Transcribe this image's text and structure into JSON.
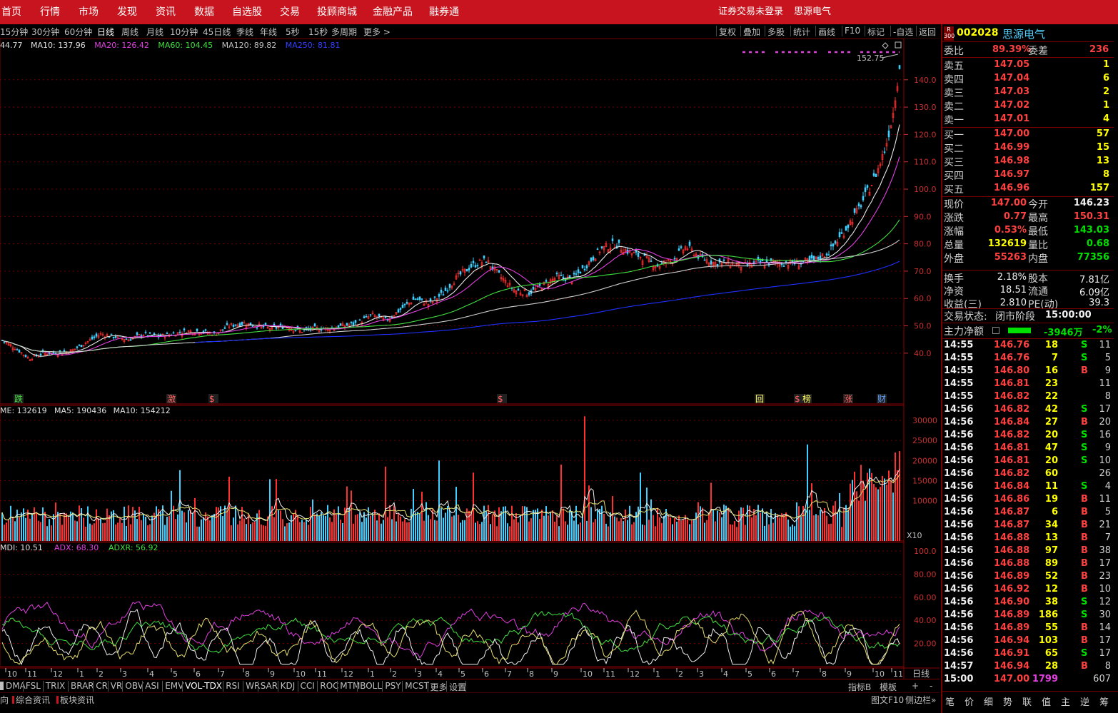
{
  "top_nav": {
    "items": [
      "首页",
      "行情",
      "市场",
      "发现",
      "资讯",
      "数据",
      "自选股",
      "交易",
      "投顾商城",
      "金融产品",
      "融券通"
    ],
    "login_status": "证券交易未登录",
    "stock_name": "思源电气"
  },
  "period_bar": {
    "items": [
      "15分钟",
      "30分钟",
      "60分钟",
      "日线",
      "周线",
      "月线",
      "10分钟",
      "45日线",
      "季线",
      "年线",
      "5秒",
      "15秒",
      "多周期",
      "更多 >"
    ],
    "active": "日线",
    "tools": [
      "复权",
      "叠加",
      "多股",
      "统计",
      "画线",
      "F10",
      "标记",
      "-自选",
      "返回"
    ]
  },
  "ma_legend": [
    {
      "text": "44.77",
      "color": "#e0e0e0"
    },
    {
      "text": "MA10: 137.96",
      "color": "#e0e0e0"
    },
    {
      "text": "MA20: 126.42",
      "color": "#e040e0"
    },
    {
      "text": "MA60: 104.45",
      "color": "#40e040"
    },
    {
      "text": "MA120: 89.82",
      "color": "#c0c0c0"
    },
    {
      "text": "MA250: 81.81",
      "color": "#3040ff"
    }
  ],
  "price_axis": [
    "140.0",
    "130.0",
    "120.0",
    "110.0",
    "100.0",
    "90.0",
    "80.0",
    "70.0",
    "60.0",
    "50.0",
    "40.0"
  ],
  "price_high_label": "152.75",
  "event_markers": [
    {
      "text": "跌",
      "color": "#40e040"
    },
    {
      "text": "激",
      "color": "#ff6060"
    },
    {
      "text": "$",
      "color": "#ff6060"
    },
    {
      "text": "$",
      "color": "#ff6060"
    },
    {
      "text": "回",
      "color": "#ffff60"
    },
    {
      "text": "$",
      "color": "#ff6060"
    },
    {
      "text": "榜",
      "color": "#ffff60"
    },
    {
      "text": "涨",
      "color": "#ff6060"
    },
    {
      "text": "财",
      "color": "#60a0ff"
    }
  ],
  "volume_legend": [
    {
      "text": "ME: 132619",
      "color": "#e0e0e0"
    },
    {
      "text": "MA5: 190436",
      "color": "#e0e0e0"
    },
    {
      "text": "MA10: 154212",
      "color": "#e0e0e0"
    }
  ],
  "volume_axis": [
    "30000",
    "25000",
    "20000",
    "15000",
    "10000"
  ],
  "volume_unit": "X10",
  "dmi_legend": [
    {
      "text": "MDI: 10.51",
      "color": "#e0e0e0"
    },
    {
      "text": "ADX: 68.30",
      "color": "#e040e0"
    },
    {
      "text": "ADXR: 56.92",
      "color": "#40e040"
    }
  ],
  "dmi_axis": [
    "100.0",
    "80.00",
    "60.00",
    "40.00",
    "20.00"
  ],
  "month_axis": [
    "10",
    "11",
    "12",
    "1",
    "2",
    "3",
    "4",
    "5",
    "6",
    "7",
    "8",
    "9",
    "10",
    "11",
    "12",
    "1",
    "2",
    "3",
    "4",
    "5",
    "6",
    "7",
    "8",
    "9",
    "10",
    "11",
    "12",
    "1",
    "2",
    "3",
    "4",
    "5",
    "6",
    "7",
    "8",
    "9",
    "10",
    "11"
  ],
  "period_label": "日线",
  "indicator_tabs": [
    "DMA",
    "FSL",
    "TRIX",
    "BRAR",
    "CR",
    "VR",
    "OBV",
    "ASI",
    "EMV",
    "VOL-TDX",
    "RSI",
    "WR",
    "SAR",
    "KDJ",
    "CCI",
    "ROC",
    "MTM",
    "BOLL",
    "PSY",
    "MCST",
    "更多",
    "设置"
  ],
  "indicator_right": [
    "指标B",
    "模板",
    "+",
    "-"
  ],
  "bottom_tabs": [
    "向",
    "综合资讯",
    "板块资讯"
  ],
  "bottom_right": [
    "图文F10",
    "侧边栏»"
  ],
  "quote": {
    "badge_top": "R",
    "badge_bottom": "300",
    "code": "002028",
    "name": "思源电气",
    "weibi_label": "委比",
    "weibi": "89.39%",
    "weicha_label": "委差",
    "weicha": "236",
    "asks": [
      {
        "label": "卖五",
        "price": "147.05",
        "vol": "1"
      },
      {
        "label": "卖四",
        "price": "147.04",
        "vol": "6"
      },
      {
        "label": "卖三",
        "price": "147.03",
        "vol": "2"
      },
      {
        "label": "卖二",
        "price": "147.02",
        "vol": "1"
      },
      {
        "label": "卖一",
        "price": "147.01",
        "vol": "4"
      }
    ],
    "bids": [
      {
        "label": "买一",
        "price": "147.00",
        "vol": "57"
      },
      {
        "label": "买二",
        "price": "146.99",
        "vol": "15"
      },
      {
        "label": "买三",
        "price": "146.98",
        "vol": "13"
      },
      {
        "label": "买四",
        "price": "146.97",
        "vol": "8"
      },
      {
        "label": "买五",
        "price": "146.96",
        "vol": "157"
      }
    ],
    "stats": [
      {
        "l1": "现价",
        "v1": "147.00",
        "c1": "red",
        "l2": "今开",
        "v2": "146.23",
        "c2": "white"
      },
      {
        "l1": "涨跌",
        "v1": "0.77",
        "c1": "red",
        "l2": "最高",
        "v2": "150.31",
        "c2": "red"
      },
      {
        "l1": "涨幅",
        "v1": "0.53%",
        "c1": "red",
        "l2": "最低",
        "v2": "143.03",
        "c2": "green"
      },
      {
        "l1": "总量",
        "v1": "132619",
        "c1": "yellow",
        "l2": "量比",
        "v2": "0.68",
        "c2": "green"
      },
      {
        "l1": "外盘",
        "v1": "55263",
        "c1": "red",
        "l2": "内盘",
        "v2": "77356",
        "c2": "green"
      }
    ],
    "stats2": [
      {
        "l1": "换手",
        "v1": "2.18%",
        "l2": "股本",
        "v2": "7.81亿"
      },
      {
        "l1": "净资",
        "v1": "18.51",
        "l2": "流通",
        "v2": "6.09亿"
      },
      {
        "l1": "收益(三)",
        "v1": "2.810",
        "l2": "PE(动)",
        "v2": "39.3"
      }
    ],
    "trade_status_label": "交易状态:",
    "trade_status": "闭市阶段",
    "trade_time": "15:00:00",
    "main_net_label": "主力净额",
    "main_net": "-3946万",
    "main_net_pct": "-2%",
    "ticks": [
      {
        "t": "14:55",
        "p": "146.76",
        "v": "18",
        "s": "S",
        "n": "11"
      },
      {
        "t": "14:55",
        "p": "146.76",
        "v": "7",
        "s": "S",
        "n": "5"
      },
      {
        "t": "14:55",
        "p": "146.80",
        "v": "16",
        "s": "B",
        "n": "9"
      },
      {
        "t": "14:55",
        "p": "146.81",
        "v": "23",
        "s": "",
        "n": "11"
      },
      {
        "t": "14:55",
        "p": "146.82",
        "v": "22",
        "s": "",
        "n": "8"
      },
      {
        "t": "14:56",
        "p": "146.82",
        "v": "42",
        "s": "S",
        "n": "17"
      },
      {
        "t": "14:56",
        "p": "146.84",
        "v": "27",
        "s": "B",
        "n": "20"
      },
      {
        "t": "14:56",
        "p": "146.82",
        "v": "20",
        "s": "S",
        "n": "16"
      },
      {
        "t": "14:56",
        "p": "146.81",
        "v": "47",
        "s": "S",
        "n": "9"
      },
      {
        "t": "14:56",
        "p": "146.81",
        "v": "20",
        "s": "S",
        "n": "10"
      },
      {
        "t": "14:56",
        "p": "146.82",
        "v": "60",
        "s": "",
        "n": "26"
      },
      {
        "t": "14:56",
        "p": "146.84",
        "v": "11",
        "s": "S",
        "n": "4"
      },
      {
        "t": "14:56",
        "p": "146.86",
        "v": "19",
        "s": "B",
        "n": "11"
      },
      {
        "t": "14:56",
        "p": "146.87",
        "v": "6",
        "s": "B",
        "n": "5"
      },
      {
        "t": "14:56",
        "p": "146.87",
        "v": "34",
        "s": "B",
        "n": "21"
      },
      {
        "t": "14:56",
        "p": "146.88",
        "v": "13",
        "s": "B",
        "n": "7"
      },
      {
        "t": "14:56",
        "p": "146.88",
        "v": "97",
        "s": "B",
        "n": "38"
      },
      {
        "t": "14:56",
        "p": "146.88",
        "v": "89",
        "s": "B",
        "n": "17"
      },
      {
        "t": "14:56",
        "p": "146.89",
        "v": "52",
        "s": "B",
        "n": "23"
      },
      {
        "t": "14:56",
        "p": "146.92",
        "v": "12",
        "s": "B",
        "n": "10"
      },
      {
        "t": "14:56",
        "p": "146.90",
        "v": "38",
        "s": "S",
        "n": "12"
      },
      {
        "t": "14:56",
        "p": "146.89",
        "v": "186",
        "s": "S",
        "n": "30"
      },
      {
        "t": "14:56",
        "p": "146.89",
        "v": "55",
        "s": "B",
        "n": "14"
      },
      {
        "t": "14:56",
        "p": "146.94",
        "v": "103",
        "s": "B",
        "n": "17"
      },
      {
        "t": "14:56",
        "p": "146.91",
        "v": "65",
        "s": "S",
        "n": "17"
      },
      {
        "t": "14:57",
        "p": "146.94",
        "v": "28",
        "s": "B",
        "n": "8"
      },
      {
        "t": "15:00",
        "p": "147.00",
        "v": "1799",
        "s": "",
        "n": "607"
      }
    ],
    "right_tabs": [
      "笔",
      "价",
      "细",
      "势",
      "联",
      "值",
      "主",
      "逆",
      "筹"
    ]
  },
  "chart_data": {
    "type": "candlestick",
    "price_range": [
      35,
      153
    ],
    "anchors": [
      [
        0,
        45
      ],
      [
        20,
        42
      ],
      [
        40,
        38
      ],
      [
        60,
        40
      ],
      [
        80,
        40
      ],
      [
        100,
        41
      ],
      [
        120,
        44
      ],
      [
        140,
        47
      ],
      [
        160,
        46
      ],
      [
        180,
        45
      ],
      [
        200,
        47
      ],
      [
        220,
        46
      ],
      [
        240,
        47
      ],
      [
        260,
        48
      ],
      [
        280,
        48
      ],
      [
        300,
        47
      ],
      [
        320,
        50
      ],
      [
        340,
        51
      ],
      [
        360,
        50
      ],
      [
        380,
        49
      ],
      [
        400,
        50
      ],
      [
        420,
        48
      ],
      [
        440,
        49
      ],
      [
        460,
        49
      ],
      [
        480,
        50
      ],
      [
        500,
        51
      ],
      [
        520,
        54
      ],
      [
        540,
        52
      ],
      [
        560,
        56
      ],
      [
        580,
        60
      ],
      [
        600,
        58
      ],
      [
        620,
        62
      ],
      [
        640,
        68
      ],
      [
        660,
        72
      ],
      [
        680,
        74
      ],
      [
        700,
        68
      ],
      [
        720,
        63
      ],
      [
        740,
        62
      ],
      [
        760,
        65
      ],
      [
        780,
        68
      ],
      [
        800,
        67
      ],
      [
        820,
        72
      ],
      [
        840,
        78
      ],
      [
        860,
        80
      ],
      [
        880,
        77
      ],
      [
        900,
        75
      ],
      [
        920,
        72
      ],
      [
        940,
        74
      ],
      [
        960,
        79
      ],
      [
        980,
        75
      ],
      [
        1000,
        73
      ],
      [
        1020,
        73
      ],
      [
        1040,
        72
      ],
      [
        1060,
        73
      ],
      [
        1080,
        73
      ],
      [
        1100,
        73
      ],
      [
        1120,
        73
      ],
      [
        1140,
        74
      ],
      [
        1160,
        77
      ],
      [
        1180,
        84
      ],
      [
        1200,
        92
      ],
      [
        1220,
        102
      ],
      [
        1230,
        108
      ],
      [
        1240,
        116
      ],
      [
        1250,
        128
      ],
      [
        1256,
        140
      ],
      [
        1260,
        147
      ]
    ],
    "volume_range": [
      0,
      33000
    ],
    "dmi_range": [
      0,
      105
    ]
  }
}
